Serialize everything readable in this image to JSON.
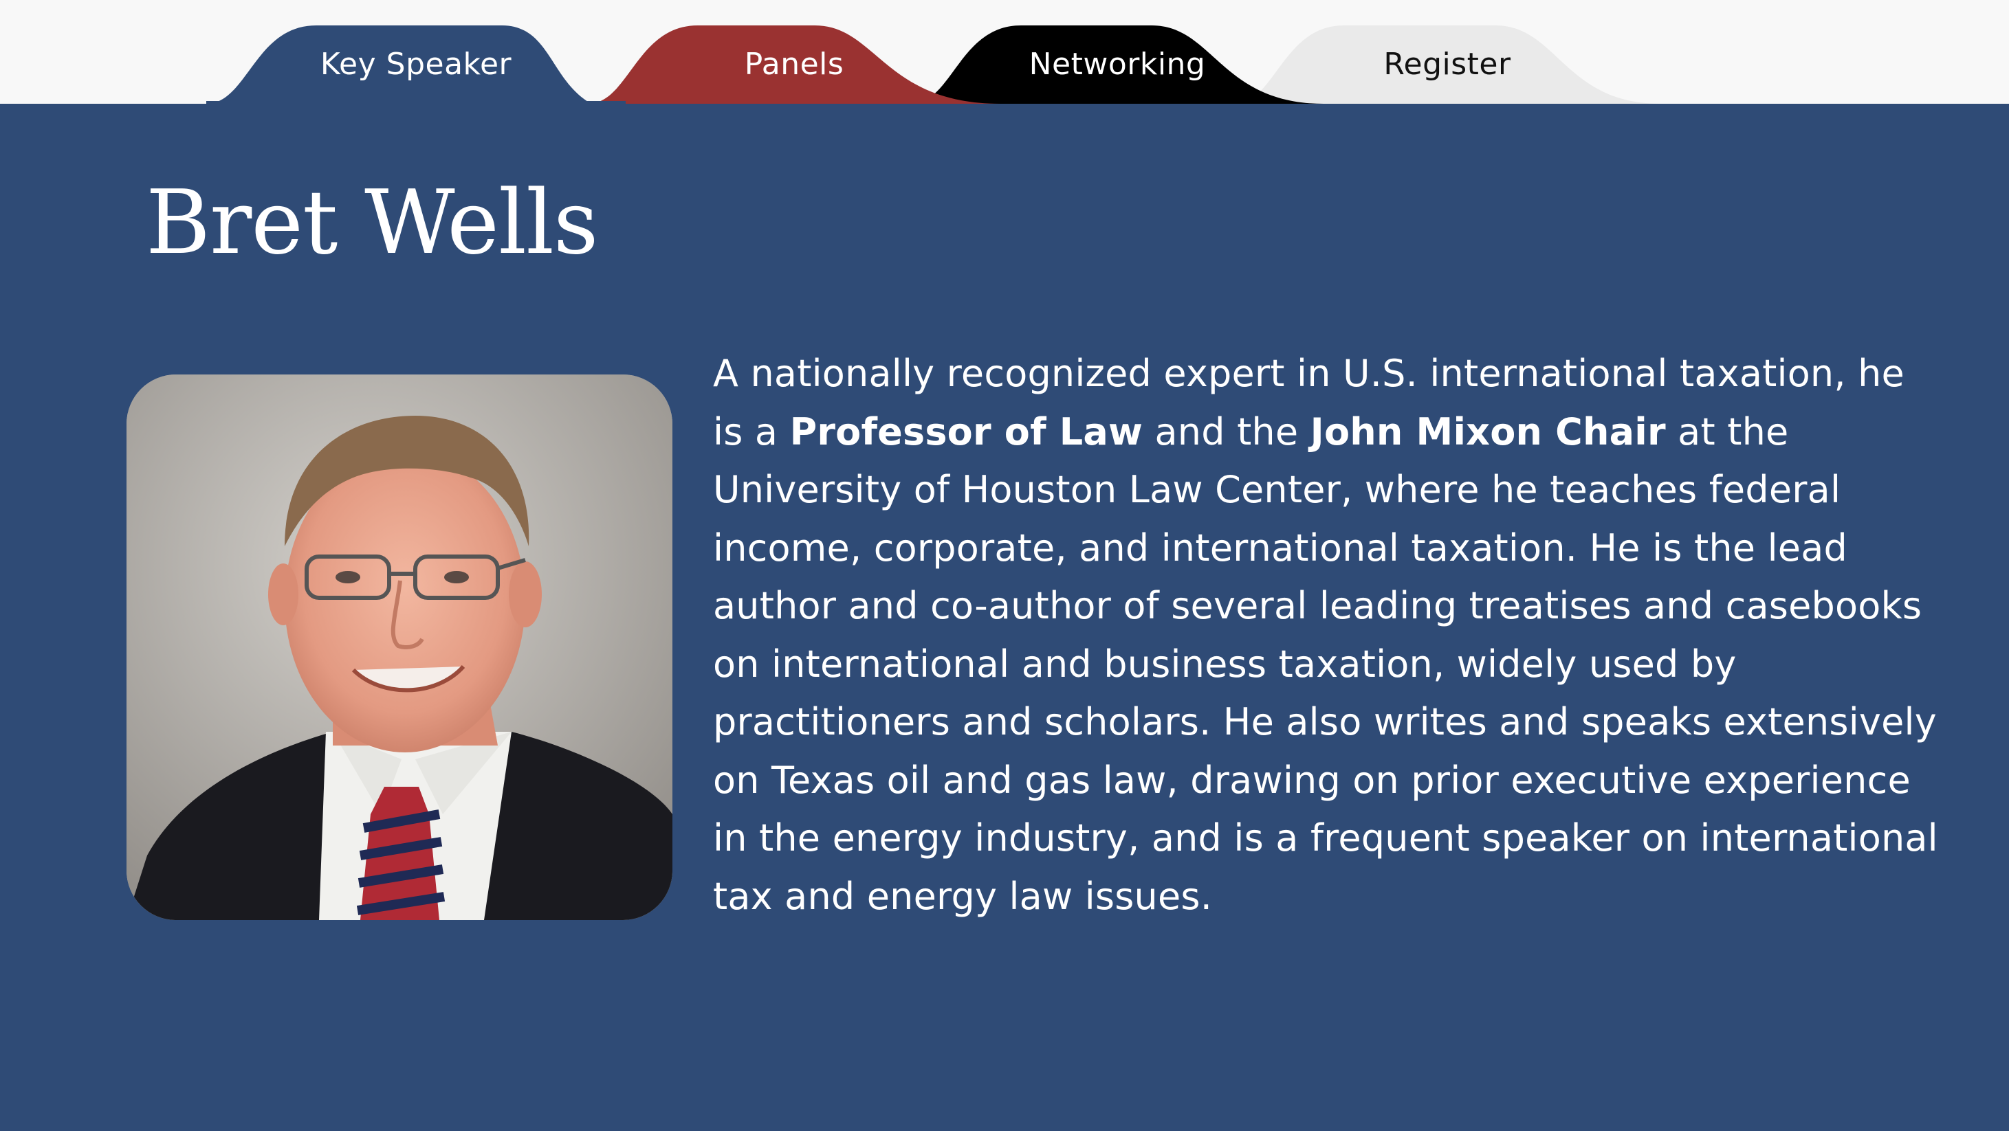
{
  "nav": {
    "tabs": [
      {
        "label": "Key Speaker",
        "color": "#2f4b76",
        "text_color": "#ffffff"
      },
      {
        "label": "Panels",
        "color": "#9a3231",
        "text_color": "#ffffff"
      },
      {
        "label": "Networking",
        "color": "#000000",
        "text_color": "#ffffff"
      },
      {
        "label": "Register",
        "color": "#eaeaea",
        "text_color": "#111111"
      }
    ]
  },
  "speaker": {
    "name": "Bret Wells",
    "bio": {
      "part1": "A nationally recognized expert in U.S. international taxation, he is a ",
      "bold1": "Professor of Law",
      "part2": " and the ",
      "bold2": "John Mixon Chair",
      "part3": " at the University of Houston Law Center, where he teaches federal income, corporate, and international taxation. He is the lead author and co-author of several leading treatises and casebooks on international and business taxation, widely used by practitioners and scholars. He also writes and speaks extensively on Texas oil and gas law, drawing on prior executive experience in the energy industry, and is a frequent speaker on international tax and energy law issues."
    }
  },
  "colors": {
    "background": "#2f4b76",
    "top_strip": "#f8f8f8"
  }
}
